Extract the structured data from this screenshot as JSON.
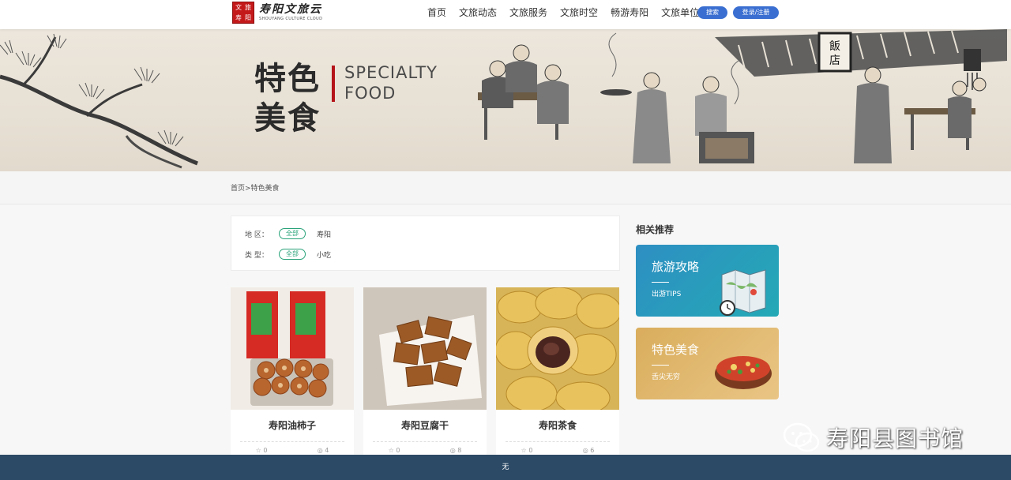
{
  "header": {
    "logo_seal": [
      "文",
      "旅",
      "寿",
      "阳"
    ],
    "logo_cn": "寿阳文旅云",
    "logo_en": "SHOUYANG CULTURE CLOUD",
    "nav": [
      "首页",
      "文旅动态",
      "文旅服务",
      "文旅时空",
      "畅游寿阳",
      "文旅单位"
    ],
    "search_label": "搜索",
    "login_label": "登录/注册"
  },
  "banner": {
    "title_cn_line1": "特色",
    "title_cn_line2": "美食",
    "title_en_line1": "SPECIALTY",
    "title_en_line2": "FOOD",
    "shop_sign": "飯店"
  },
  "breadcrumb": "首页>特色美食",
  "filters": {
    "region_label": "地 区：",
    "region_all": "全部",
    "region_option": "寿阳",
    "type_label": "类 型：",
    "type_all": "全部",
    "type_option": "小吃"
  },
  "cards": [
    {
      "title": "寿阳油柿子",
      "likes": "0",
      "views": "4"
    },
    {
      "title": "寿阳豆腐干",
      "likes": "0",
      "views": "8"
    },
    {
      "title": "寿阳茶食",
      "likes": "0",
      "views": "6"
    }
  ],
  "sidebar": {
    "title": "相关推荐",
    "rec1_title": "旅游攻略",
    "rec1_sub": "出游TIPS",
    "rec2_title": "特色美食",
    "rec2_sub": "舌尖无穷"
  },
  "watermark": "寿阳县图书馆",
  "footer": "无",
  "colors": {
    "accent_blue": "#3a6fd1",
    "chip_green": "#2aa37a",
    "seal_red": "#c4191b",
    "footer_bg": "#2c4a66"
  }
}
